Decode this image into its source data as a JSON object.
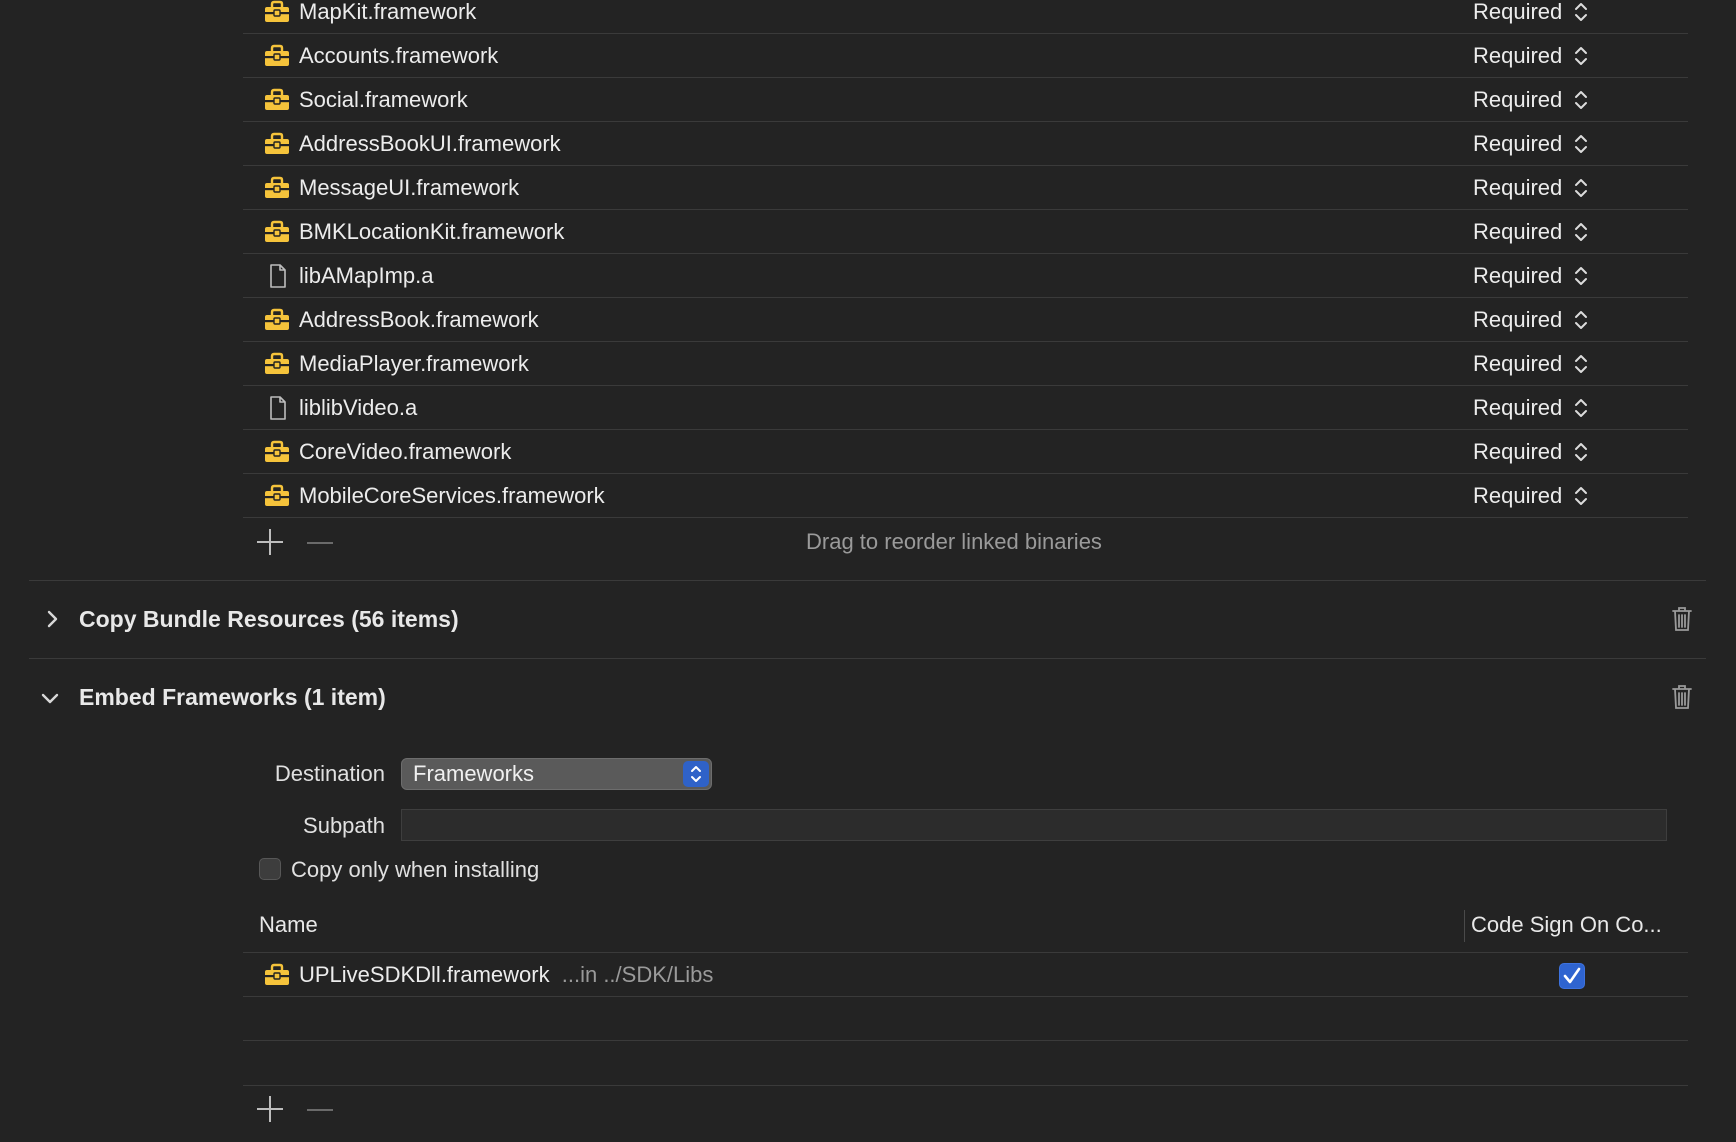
{
  "linked_binaries": [
    {
      "name": "MapKit.framework",
      "kind": "framework",
      "status": "Required"
    },
    {
      "name": "Accounts.framework",
      "kind": "framework",
      "status": "Required"
    },
    {
      "name": "Social.framework",
      "kind": "framework",
      "status": "Required"
    },
    {
      "name": "AddressBookUI.framework",
      "kind": "framework",
      "status": "Required"
    },
    {
      "name": "MessageUI.framework",
      "kind": "framework",
      "status": "Required"
    },
    {
      "name": "BMKLocationKit.framework",
      "kind": "framework",
      "status": "Required"
    },
    {
      "name": "libAMapImp.a",
      "kind": "file",
      "status": "Required"
    },
    {
      "name": "AddressBook.framework",
      "kind": "framework",
      "status": "Required"
    },
    {
      "name": "MediaPlayer.framework",
      "kind": "framework",
      "status": "Required"
    },
    {
      "name": "liblibVideo.a",
      "kind": "file",
      "status": "Required"
    },
    {
      "name": "CoreVideo.framework",
      "kind": "framework",
      "status": "Required"
    },
    {
      "name": "MobileCoreServices.framework",
      "kind": "framework",
      "status": "Required"
    }
  ],
  "linked_hint": "Drag to reorder linked binaries",
  "copy_bundle": {
    "title": "Copy Bundle Resources (56 items)",
    "expanded": false
  },
  "embed": {
    "title": "Embed Frameworks (1 item)",
    "expanded": true,
    "destination_label": "Destination",
    "destination_value": "Frameworks",
    "subpath_label": "Subpath",
    "subpath_value": "",
    "copy_only_label": "Copy only when installing",
    "copy_only_checked": false,
    "col_name": "Name",
    "col_codesign": "Code Sign On Co...",
    "items": [
      {
        "name": "UPLiveSDKDll.framework",
        "path": "...in ../SDK/Libs",
        "code_sign": true
      }
    ]
  },
  "colors": {
    "background": "#232323",
    "framework_icon": "#f5c33b",
    "accent": "#2f64d0"
  }
}
